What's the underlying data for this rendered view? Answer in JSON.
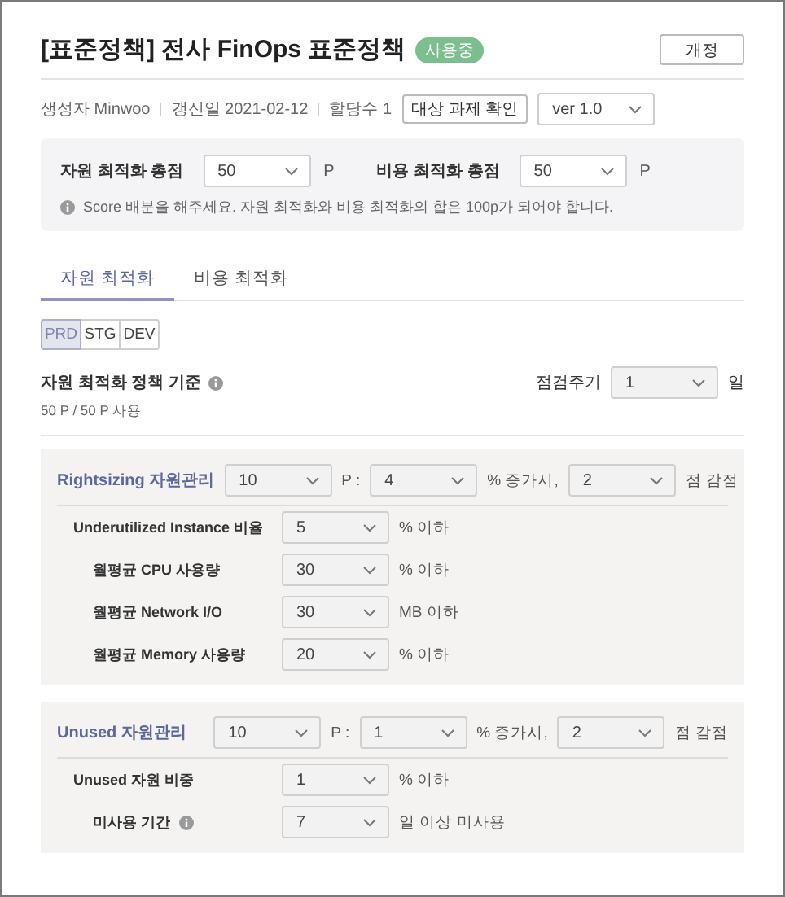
{
  "header": {
    "title": "[표준정책] 전사 FinOps 표준정책",
    "status_badge": "사용중",
    "revise_button": "개정"
  },
  "meta": {
    "creator": "생성자 Minwoo",
    "updated": "갱신일 2021-02-12",
    "assigned": "할당수 1",
    "target_button": "대상 과제 확인",
    "version": "ver 1.0"
  },
  "score": {
    "fields": [
      {
        "label": "자원 최적화 총점",
        "value": "50",
        "unit": "P"
      },
      {
        "label": "비용 최적화 총점",
        "value": "50",
        "unit": "P"
      }
    ],
    "note": "Score 배분을 해주세요. 자원 최적화와 비용 최적화의 합은 100p가 되어야 합니다."
  },
  "tabs": [
    {
      "label": "자원 최적화",
      "selected": true
    },
    {
      "label": "비용 최적화",
      "selected": false
    }
  ],
  "env_tabs": [
    {
      "label": "PRD",
      "selected": true
    },
    {
      "label": "STG",
      "selected": false
    },
    {
      "label": "DEV",
      "selected": false
    }
  ],
  "policy": {
    "title": "자원 최적화 정책 기준",
    "info": true,
    "usage": "50 P / 50 P 사용",
    "cycle_label": "점검주기",
    "cycle_value": "1",
    "cycle_unit": "일"
  },
  "groups": [
    {
      "title": "Rightsizing 자원관리",
      "points": "10",
      "points_sep": "P :",
      "threshold": "4",
      "threshold_unit": "% 증가시,",
      "penalty": "2",
      "penalty_unit": "점 감점",
      "rows": [
        {
          "label": "Underutilized Instance 비율",
          "info": false,
          "value": "5",
          "unit": "% 이하",
          "children": [
            {
              "label": "월평균 CPU 사용량",
              "info": false,
              "value": "30",
              "unit": "% 이하"
            },
            {
              "label": "월평균 Network I/O",
              "info": false,
              "value": "30",
              "unit": "MB 이하"
            },
            {
              "label": "월평균 Memory 사용량",
              "info": false,
              "value": "20",
              "unit": "% 이하"
            }
          ]
        }
      ]
    },
    {
      "title": "Unused 자원관리",
      "points": "10",
      "points_sep": "P :",
      "threshold": "1",
      "threshold_unit": "% 증가시,",
      "penalty": "2",
      "penalty_unit": "점 감점",
      "rows": [
        {
          "label": "Unused 자원 비중",
          "info": false,
          "value": "1",
          "unit": "% 이하",
          "children": [
            {
              "label": "미사용 기간",
              "info": true,
              "value": "7",
              "unit": "일 이상 미사용"
            }
          ]
        }
      ]
    }
  ]
}
